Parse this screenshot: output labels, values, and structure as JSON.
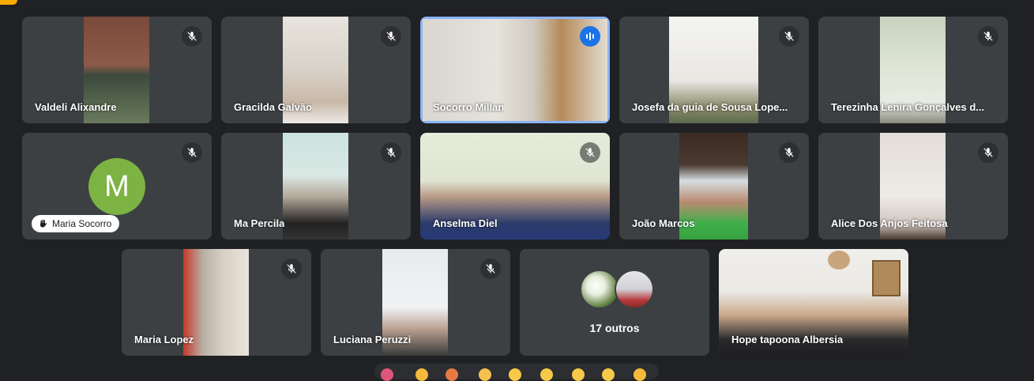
{
  "participants": [
    {
      "name": "Valdeli Alixandre"
    },
    {
      "name": "Gracilda Galvão"
    },
    {
      "name": "Socorro Millan"
    },
    {
      "name": "Josefa da guia de Sousa Lope..."
    },
    {
      "name": "Terezinha Lenira Gonçalves d..."
    },
    {
      "initial": "M",
      "chip_name": "Maria Socorro"
    },
    {
      "name": "Ma Percila"
    },
    {
      "name": "Anselma Diel"
    },
    {
      "name": "João Marcos"
    },
    {
      "name": "Alice Dos Anjos Feitosa"
    },
    {
      "name": "Maria Lopez"
    },
    {
      "name": "Luciana Peruzzi"
    },
    {
      "others_label": "17 outros"
    },
    {
      "name": "Hope tapoona Albersia"
    }
  ],
  "colors": {
    "background": "#202124",
    "tile": "#3c4043",
    "active_speaker_border": "#8ab4f8",
    "speaking_indicator": "#1a73e8",
    "avatar_green": "#7cb342"
  },
  "icons": {
    "muted": "mic-off-icon",
    "speaking": "audio-levels-icon",
    "hand": "raised-hand-icon"
  }
}
